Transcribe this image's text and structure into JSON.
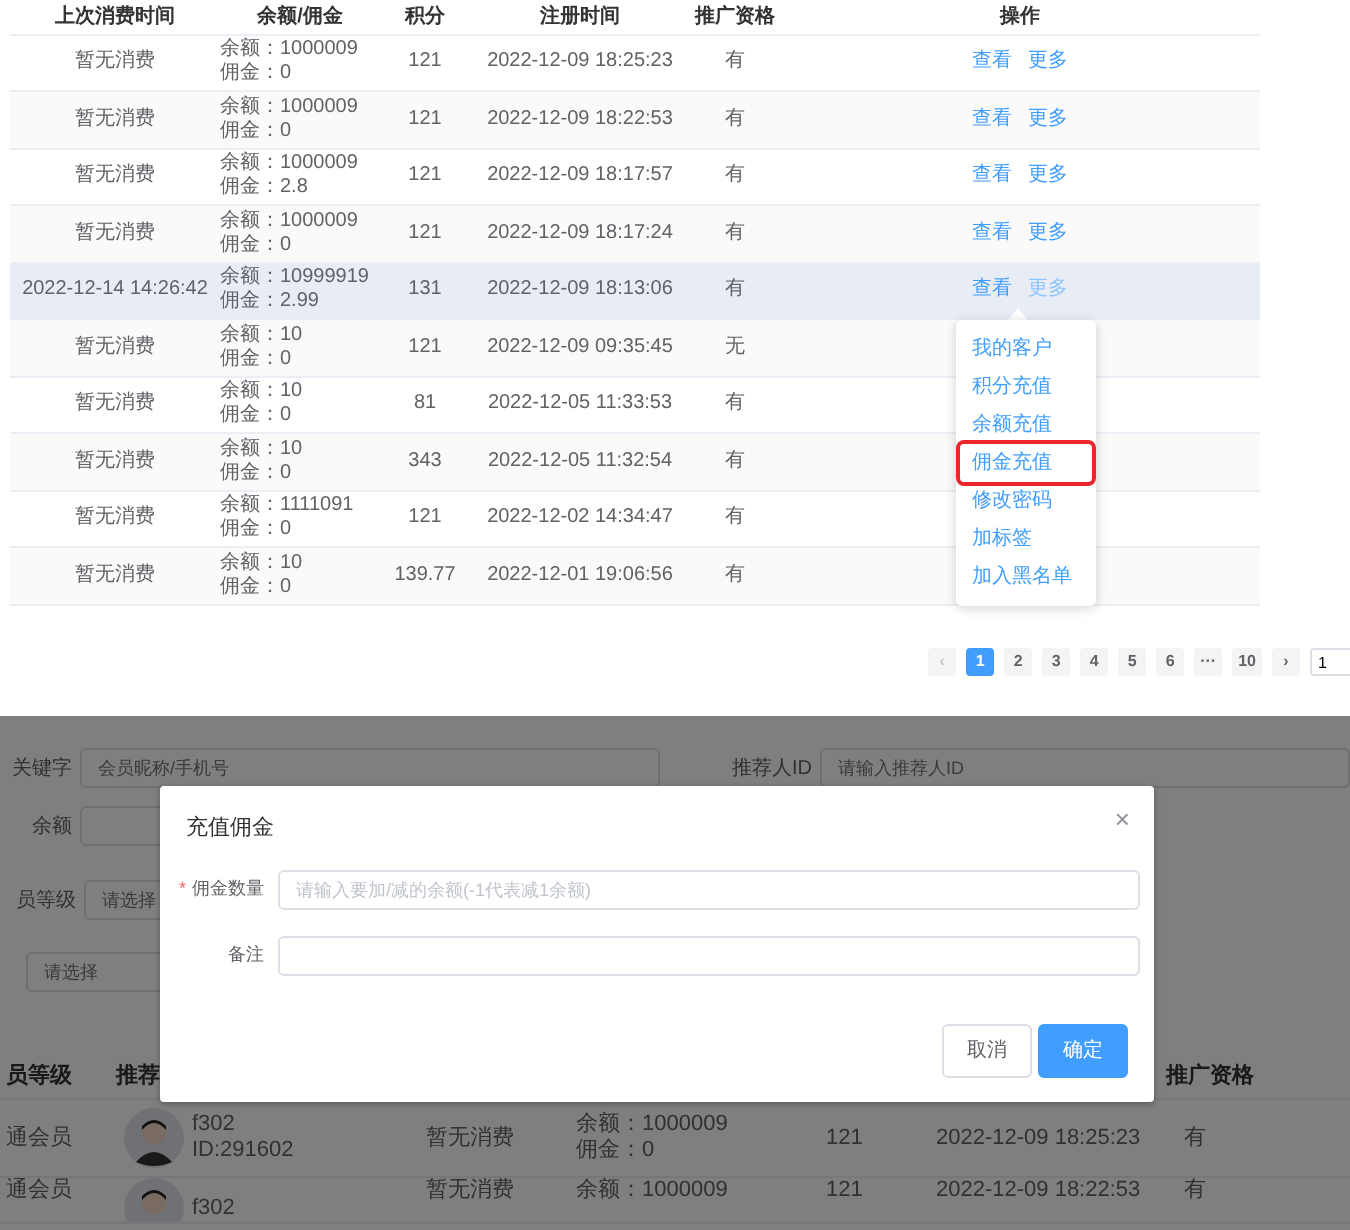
{
  "top_table": {
    "columns": [
      "上次消费时间",
      "余额/佣金",
      "积分",
      "注册时间",
      "推广资格",
      "操作"
    ],
    "rows": [
      {
        "last_consume": "暂无消费",
        "balance": "余额：1000009",
        "commission": "佣金：0",
        "points": "121",
        "registered": "2022-12-09 18:25:23",
        "promo": "有",
        "hovered": false,
        "actions": [
          {
            "label": "查看",
            "active": false
          },
          {
            "label": "更多",
            "active": false
          }
        ]
      },
      {
        "last_consume": "暂无消费",
        "balance": "余额：1000009",
        "commission": "佣金：0",
        "points": "121",
        "registered": "2022-12-09 18:22:53",
        "promo": "有",
        "hovered": false,
        "actions": [
          {
            "label": "查看",
            "active": false
          },
          {
            "label": "更多",
            "active": false
          }
        ]
      },
      {
        "last_consume": "暂无消费",
        "balance": "余额：1000009",
        "commission": "佣金：2.8",
        "points": "121",
        "registered": "2022-12-09 18:17:57",
        "promo": "有",
        "hovered": false,
        "actions": [
          {
            "label": "查看",
            "active": false
          },
          {
            "label": "更多",
            "active": false
          }
        ]
      },
      {
        "last_consume": "暂无消费",
        "balance": "余额：1000009",
        "commission": "佣金：0",
        "points": "121",
        "registered": "2022-12-09 18:17:24",
        "promo": "有",
        "hovered": false,
        "actions": [
          {
            "label": "查看",
            "active": false
          },
          {
            "label": "更多",
            "active": false
          }
        ]
      },
      {
        "last_consume": "2022-12-14 14:26:42",
        "balance": "余额：10999919",
        "commission": "佣金：2.99",
        "points": "131",
        "registered": "2022-12-09 18:13:06",
        "promo": "有",
        "hovered": true,
        "actions": [
          {
            "label": "查看",
            "active": false
          },
          {
            "label": "更多",
            "active": true
          }
        ]
      },
      {
        "last_consume": "暂无消费",
        "balance": "余额：10",
        "commission": "佣金：0",
        "points": "121",
        "registered": "2022-12-09 09:35:45",
        "promo": "无",
        "hovered": false
      },
      {
        "last_consume": "暂无消费",
        "balance": "余额：10",
        "commission": "佣金：0",
        "points": "81",
        "registered": "2022-12-05 11:33:53",
        "promo": "有",
        "hovered": false
      },
      {
        "last_consume": "暂无消费",
        "balance": "余额：10",
        "commission": "佣金：0",
        "points": "343",
        "registered": "2022-12-05 11:32:54",
        "promo": "有",
        "hovered": false
      },
      {
        "last_consume": "暂无消费",
        "balance": "余额：1111091",
        "commission": "佣金：0",
        "points": "121",
        "registered": "2022-12-02 14:34:47",
        "promo": "有",
        "hovered": false
      },
      {
        "last_consume": "暂无消费",
        "balance": "余额：10",
        "commission": "佣金：0",
        "points": "139.77",
        "registered": "2022-12-01 19:06:56",
        "promo": "有",
        "hovered": false
      }
    ]
  },
  "more_menu": {
    "items": [
      {
        "label": "我的客户",
        "outlined": false
      },
      {
        "label": "积分充值",
        "outlined": false
      },
      {
        "label": "余额充值",
        "outlined": false
      },
      {
        "label": "佣金充值",
        "outlined": true
      },
      {
        "label": "修改密码",
        "outlined": false
      },
      {
        "label": "加标签",
        "outlined": false
      },
      {
        "label": "加入黑名单",
        "outlined": false
      }
    ]
  },
  "pagination": {
    "prev": {
      "label": "‹",
      "disabled": true
    },
    "pages": [
      {
        "label": "1",
        "selected": true
      },
      {
        "label": "2",
        "selected": false
      },
      {
        "label": "3",
        "selected": false
      },
      {
        "label": "4",
        "selected": false
      },
      {
        "label": "5",
        "selected": false
      },
      {
        "label": "6",
        "selected": false
      },
      {
        "label": "···",
        "selected": false
      },
      {
        "label": "10",
        "selected": false
      }
    ],
    "next": {
      "label": "›",
      "disabled": false
    },
    "jump_value": "1"
  },
  "background_page": {
    "filters": [
      {
        "label": "关键字",
        "placeholder": "会员昵称/手机号"
      },
      {
        "label": "推荐人ID",
        "placeholder": "请输入推荐人ID"
      },
      {
        "label": "余额"
      },
      {
        "label": "员等级",
        "placeholder": "请选择"
      },
      {
        "placeholder": "请选择"
      }
    ],
    "table": {
      "columns": [
        "员等级",
        "推荐",
        "推广资格"
      ],
      "rows": [
        {
          "level": "通会员",
          "name": "f302",
          "id": "ID:291602",
          "last_consume": "暂无消费",
          "balance": "余额：1000009",
          "commission": "佣金：0",
          "points": "121",
          "registered": "2022-12-09 18:25:23",
          "promo": "有"
        },
        {
          "level": "通会员",
          "name": "f302",
          "last_consume": "暂无消费",
          "balance": "余额：1000009",
          "points": "121",
          "registered": "2022-12-09 18:22:53",
          "promo": "有"
        }
      ]
    }
  },
  "modal": {
    "title": "充值佣金",
    "close": "×",
    "fields": [
      {
        "label": "佣金数量",
        "required_mark": "*",
        "placeholder": "请输入要加/减的余额(-1代表减1余额)"
      },
      {
        "label": "备注"
      }
    ],
    "buttons": [
      {
        "label": "取消",
        "kind": "default"
      },
      {
        "label": "确定",
        "kind": "primary"
      }
    ]
  }
}
